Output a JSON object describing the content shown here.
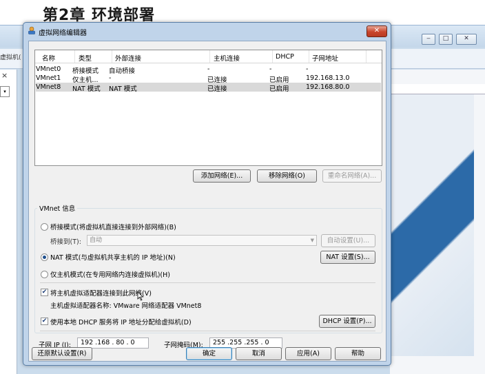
{
  "document": {
    "heading": "第2章 环境部署"
  },
  "background_window": {
    "tab_label": "虚拟机(",
    "close_glyph": "×",
    "dropdown_glyph": "▾",
    "controls": [
      "‒",
      "□",
      "✕"
    ]
  },
  "dialog": {
    "title": "虚拟网络编辑器",
    "close_glyph": "✕",
    "table": {
      "columns": [
        "名称",
        "类型",
        "外部连接",
        "主机连接",
        "DHCP",
        "子网地址"
      ],
      "rows": [
        {
          "name": "VMnet0",
          "type": "桥接模式",
          "external": "自动桥接",
          "host": "-",
          "dhcp": "-",
          "subnet": "-"
        },
        {
          "name": "VMnet1",
          "type": "仅主机...",
          "external": "-",
          "host": "已连接",
          "dhcp": "已启用",
          "subnet": "192.168.13.0"
        },
        {
          "name": "VMnet8",
          "type": "NAT 模式",
          "external": "NAT 模式",
          "host": "已连接",
          "dhcp": "已启用",
          "subnet": "192.168.80.0"
        }
      ],
      "selected_row": 2
    },
    "table_buttons": {
      "add": "添加网络(E)...",
      "remove": "移除网络(O)",
      "rename": "重命名网络(A)..."
    },
    "vmnet_info": {
      "legend": "VMnet 信息",
      "bridged_label": "桥接模式(将虚拟机直接连接到外部网络)(B)",
      "bridged_to_label": "桥接到(T):",
      "bridged_to_value": "自动",
      "auto_settings": "自动设置(U)...",
      "nat_label": "NAT 模式(与虚拟机共享主机的 IP 地址)(N)",
      "nat_settings": "NAT 设置(S)...",
      "hostonly_label": "仅主机模式(在专用网络内连接虚拟机)(H)",
      "selected_mode": "nat",
      "connect_adapter_label": "将主机虚拟适配器连接到此网络(V)",
      "connect_adapter_checked": true,
      "adapter_name_label": "主机虚拟适配器名称: VMware 网络适配器 VMnet8",
      "dhcp_label": "使用本地 DHCP 服务将 IP 地址分配给虚拟机(D)",
      "dhcp_checked": true,
      "dhcp_settings": "DHCP 设置(P)..."
    },
    "subnet": {
      "ip_label": "子网 IP (I):",
      "ip_value": "192 .168 . 80 . 0",
      "mask_label": "子网掩码(M):",
      "mask_value": "255 .255 .255 . 0"
    },
    "footer": {
      "restore": "还原默认设置(R)",
      "ok": "确定",
      "cancel": "取消",
      "apply": "应用(A)",
      "help": "帮助"
    }
  }
}
